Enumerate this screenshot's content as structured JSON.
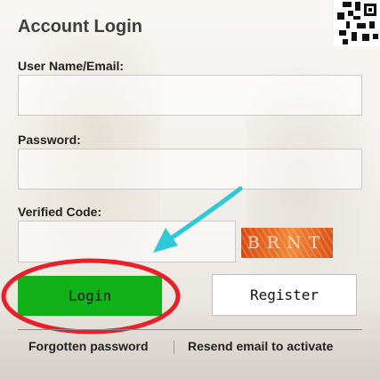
{
  "login_panel": {
    "title": "Account Login",
    "username_label": "User Name/Email:",
    "username_value": "",
    "password_label": "Password:",
    "password_value": "",
    "code_label": "Verified Code:",
    "code_value": "",
    "captcha_text": "BRNT",
    "login_label": "Login",
    "register_label": "Register",
    "forgot_label": "Forgotten password",
    "resend_label": "Resend email to activate"
  },
  "colors": {
    "login_button": "#11b11a",
    "annotation_circle": "#e8202a",
    "annotation_arrow": "#2ec8d8",
    "captcha_bg": "#e0641f"
  },
  "icons": {
    "qr": "qr-code-icon"
  }
}
